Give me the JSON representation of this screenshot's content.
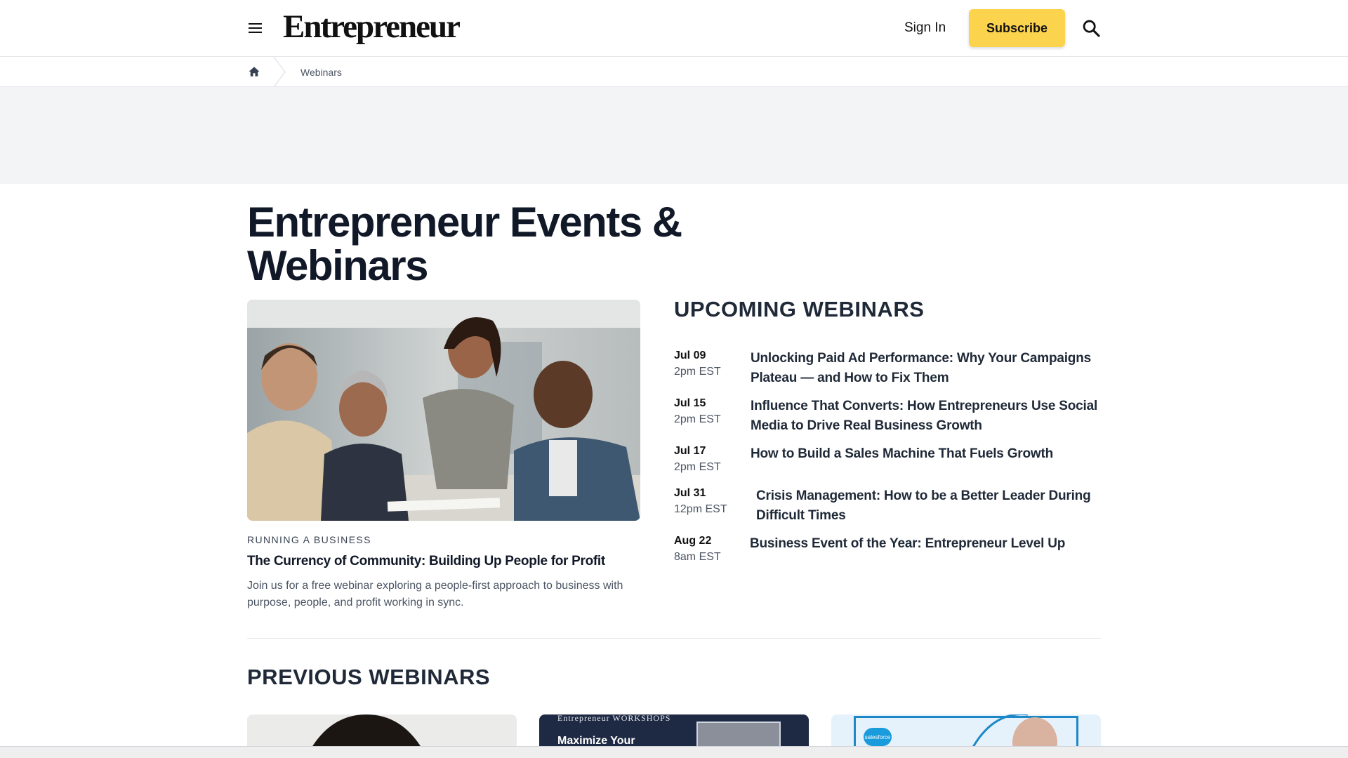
{
  "header": {
    "logo": "Entrepreneur",
    "sign_in": "Sign In",
    "subscribe": "Subscribe",
    "icons": [
      "menu-icon",
      "search-icon"
    ]
  },
  "breadcrumb": {
    "home_icon": "home-icon",
    "current": "Webinars"
  },
  "page": {
    "title": "Entrepreneur Events & Webinars"
  },
  "featured": {
    "category": "RUNNING A BUSINESS",
    "title": "The Currency of Community: Building Up People for Profit",
    "description": "Join us for a free webinar exploring a people-first approach to business with purpose, people, and profit working in sync."
  },
  "upcoming": {
    "heading": "UPCOMING WEBINARS",
    "events": [
      {
        "date": "Jul 09",
        "time": "2pm EST",
        "title": "Unlocking Paid Ad Performance: Why Your Campaigns Plateau — and How to Fix Them"
      },
      {
        "date": "Jul 15",
        "time": "2pm EST",
        "title": "Influence That Converts: How Entrepreneurs Use Social Media to Drive Real Business Growth"
      },
      {
        "date": "Jul 17",
        "time": "2pm EST",
        "title": "How to Build a Sales Machine That Fuels Growth"
      },
      {
        "date": "Jul 31",
        "time": "12pm EST",
        "title": "Crisis Management: How to be a Better Leader During Difficult Times"
      },
      {
        "date": "Aug 22",
        "time": "8am EST",
        "title": "Business Event of the Year: Entrepreneur Level Up"
      }
    ]
  },
  "previous": {
    "heading": "PREVIOUS WEBINARS",
    "cards": [
      {
        "brand": "",
        "text": ""
      },
      {
        "brand": "Entrepreneur WORKSHOPS",
        "text": "Maximize Your"
      },
      {
        "brand": "salesforce",
        "text": ""
      }
    ]
  },
  "colors": {
    "accent": "#fcd34d",
    "heading": "#111827",
    "muted": "#4b5563",
    "band": "#f3f4f6"
  }
}
